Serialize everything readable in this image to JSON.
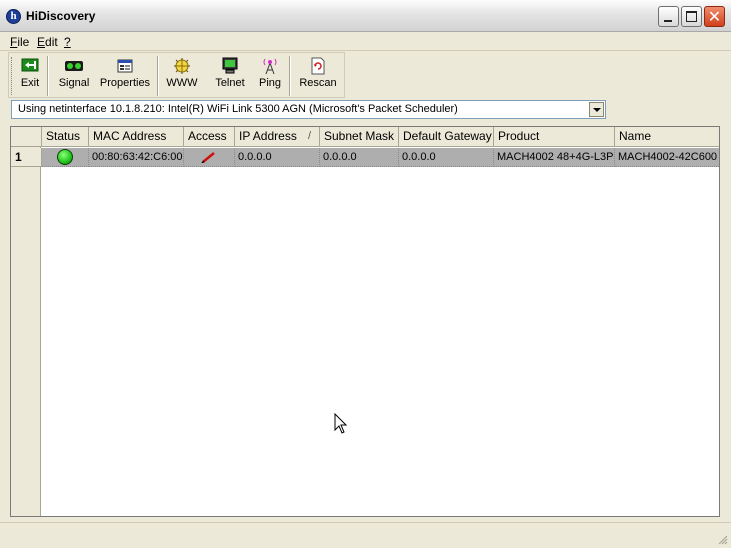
{
  "window": {
    "title": "HiDiscovery",
    "app_icon_glyph": "h"
  },
  "menu": {
    "file": {
      "accel": "F",
      "rest": "ile"
    },
    "edit": {
      "accel": "E",
      "rest": "dit"
    },
    "help": {
      "accel": "?",
      "rest": ""
    }
  },
  "toolbar": {
    "exit": "Exit",
    "signal": "Signal",
    "properties": "Properties",
    "www": "WWW",
    "telnet": "Telnet",
    "ping": "Ping",
    "rescan": "Rescan"
  },
  "interface_select": {
    "value": "Using netinterface 10.1.8.210: Intel(R) WiFi Link 5300 AGN (Microsoft's Packet Scheduler)"
  },
  "table": {
    "columns": [
      "Status",
      "MAC Address",
      "Access",
      "IP Address",
      "Subnet Mask",
      "Default Gateway",
      "Product",
      "Name"
    ],
    "sort_indicator": "/",
    "rows": [
      {
        "number": "1",
        "status": "online",
        "mac": "00:80:63:42:C6:00",
        "access": "read-write",
        "ip": "0.0.0.0",
        "subnet": "0.0.0.0",
        "gateway": "0.0.0.0",
        "product": "MACH4002 48+4G-L3P",
        "name": "MACH4002-42C600"
      }
    ]
  },
  "colors": {
    "status_online": "#22c41a",
    "selected_row": "#aeaeae",
    "window_bg": "#ece9d8",
    "close_button": "#d0401c"
  },
  "icons": {
    "exit": "exit-door-icon",
    "signal": "signal-lights-icon",
    "properties": "properties-icon",
    "www": "www-globe-icon",
    "telnet": "telnet-terminal-icon",
    "ping": "ping-antenna-icon",
    "rescan": "rescan-document-icon"
  }
}
